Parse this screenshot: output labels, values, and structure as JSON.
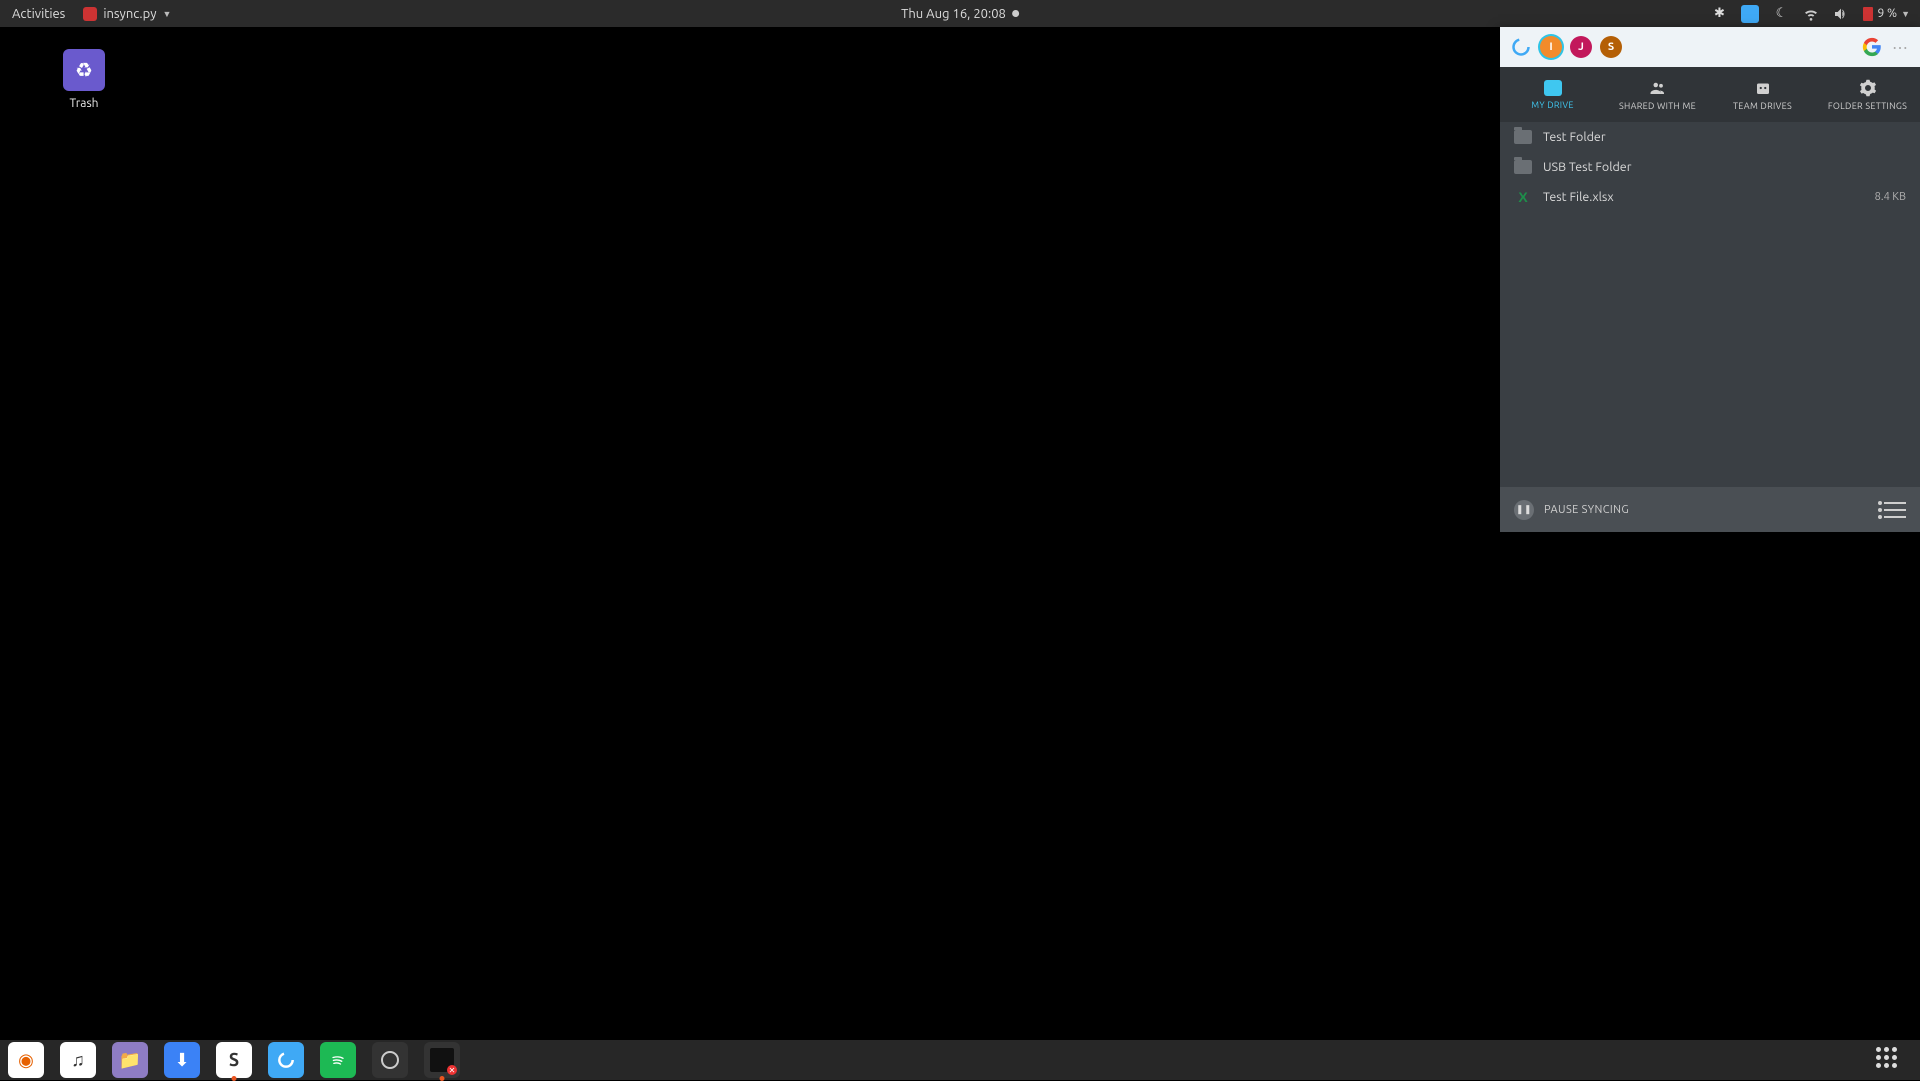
{
  "topbar": {
    "activities": "Activities",
    "app_name": "insync.py",
    "datetime": "Thu Aug 16, 20:08",
    "battery_percent": "9 %"
  },
  "desktop": {
    "trash_label": "Trash"
  },
  "insync": {
    "avatars": [
      {
        "letter": "I",
        "color": "#f28b2b"
      },
      {
        "letter": "J",
        "color": "#c2185b"
      },
      {
        "letter": "S",
        "color": "#b45f06"
      }
    ],
    "tabs": {
      "my_drive": "MY DRIVE",
      "shared": "SHARED WITH ME",
      "team": "TEAM DRIVES",
      "settings": "FOLDER SETTINGS"
    },
    "files": [
      {
        "type": "folder",
        "name": "Test Folder",
        "size": ""
      },
      {
        "type": "folder",
        "name": "USB Test Folder",
        "size": ""
      },
      {
        "type": "xlsx",
        "name": "Test File.xlsx",
        "size": "8.4 KB"
      }
    ],
    "footer": {
      "pause": "PAUSE SYNCING"
    }
  }
}
